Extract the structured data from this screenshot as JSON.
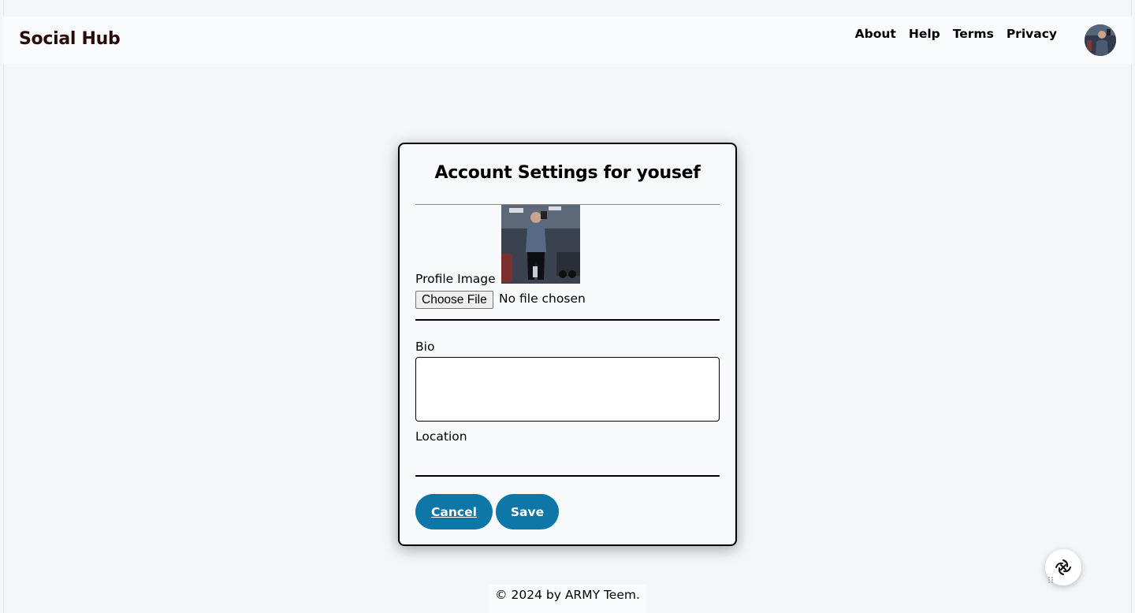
{
  "brand": "Social Hub",
  "nav": {
    "links": [
      "About",
      "Help",
      "Terms",
      "Privacy"
    ]
  },
  "icons": {
    "avatar": "user-avatar-photo",
    "assistant": "assistant-knot-icon"
  },
  "form": {
    "title": "Account Settings for yousef",
    "profile_label": "Profile Image",
    "file_button": "Choose File",
    "file_status": "No file chosen",
    "bio_label": "Bio",
    "bio_value": "",
    "location_label": "Location",
    "location_value": "",
    "cancel_label": "Cancel",
    "save_label": "Save"
  },
  "footer": "© 2024 by ARMY Teem.",
  "colors": {
    "primary_button": "#0f76a8",
    "brand_text": "#2a0a08",
    "page_bg": "#f4f7fa"
  }
}
